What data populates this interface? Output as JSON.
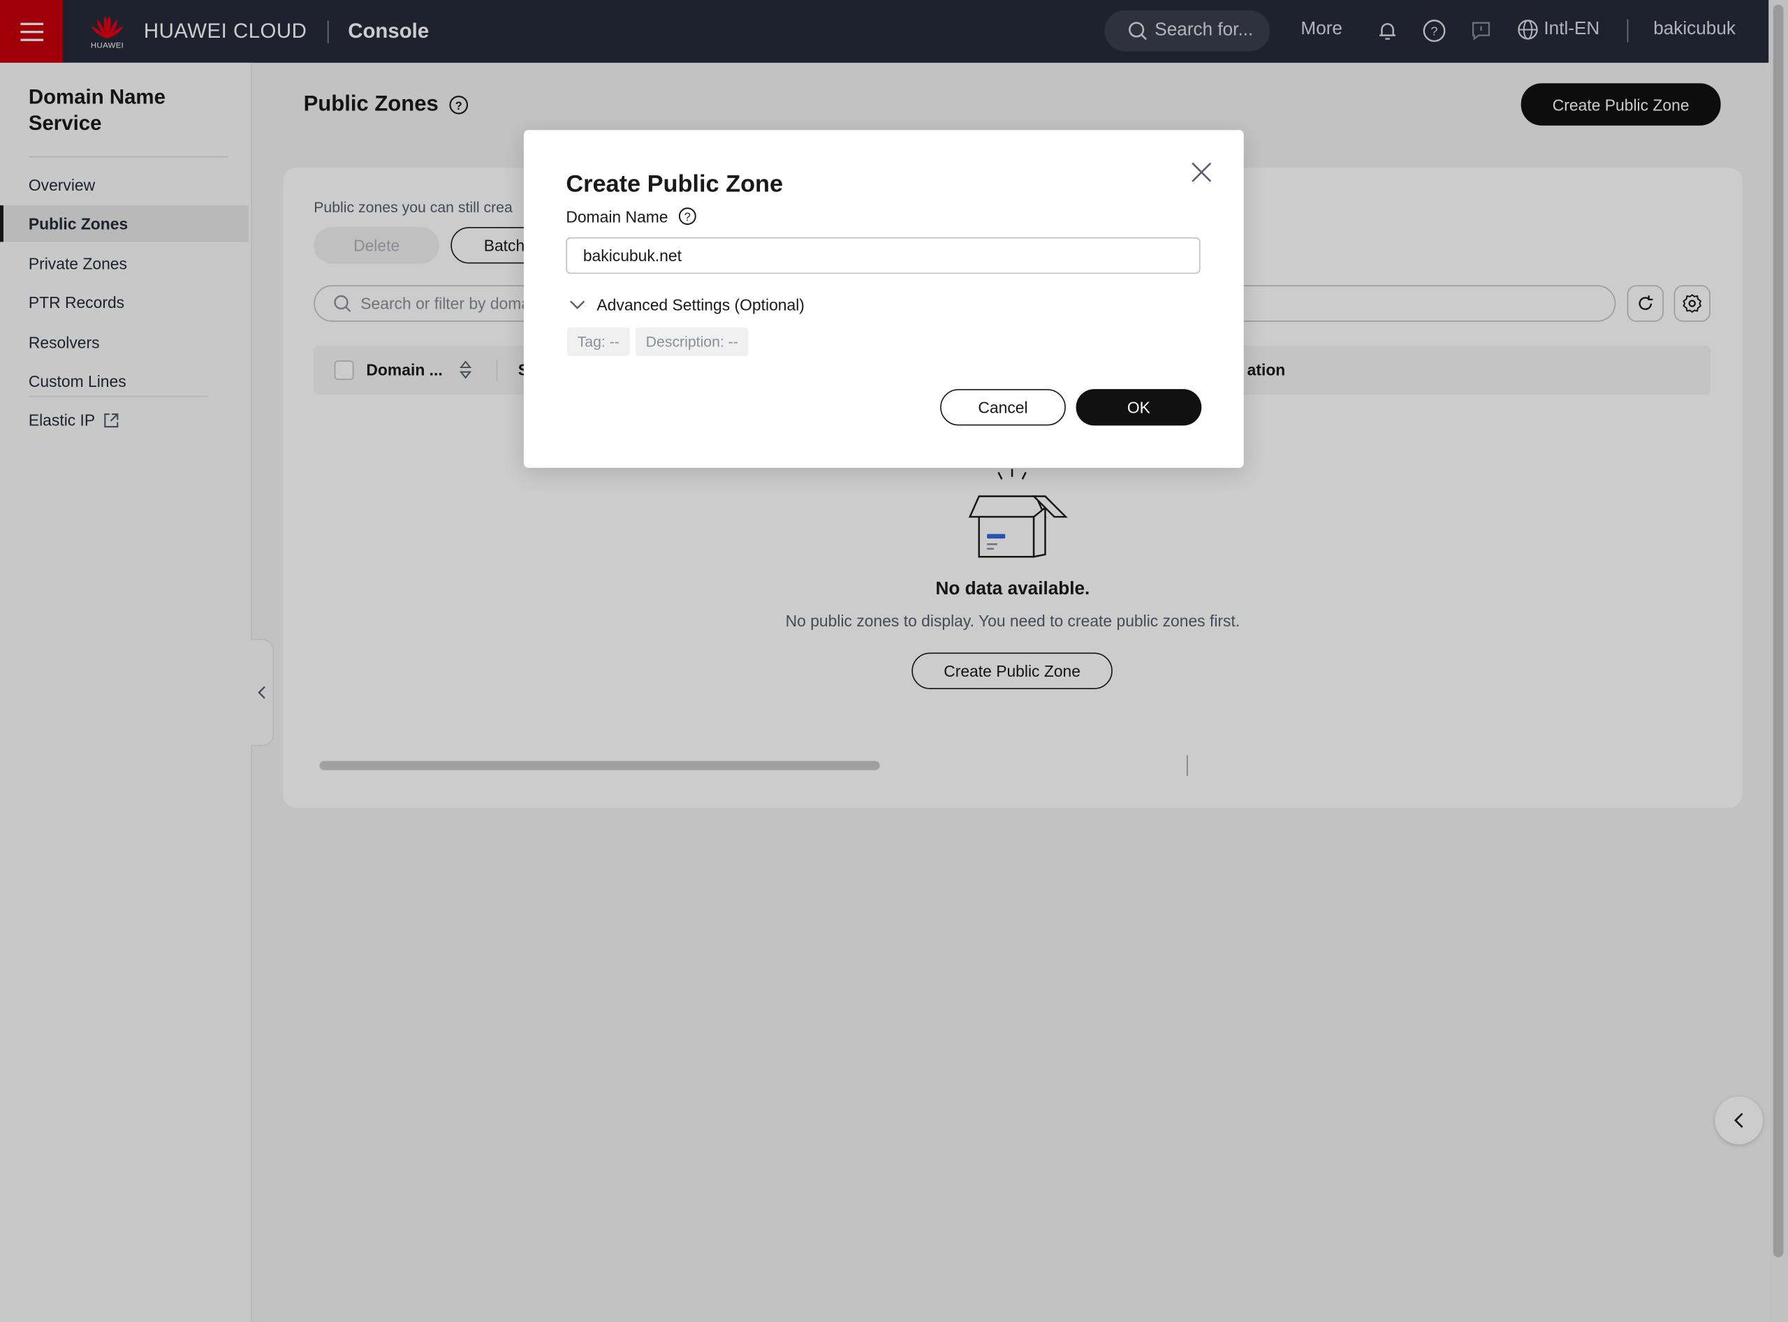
{
  "topbar": {
    "logo_text": "HUAWEI",
    "brand": "HUAWEI CLOUD",
    "console": "Console",
    "search_placeholder": "Search for...",
    "more": "More",
    "language": "Intl-EN",
    "username": "bakicubuk",
    "icons": [
      "menu-icon",
      "bell-icon",
      "help-icon",
      "feedback-icon",
      "globe-icon"
    ]
  },
  "sidebar": {
    "title": "Domain Name Service",
    "items": [
      {
        "label": "Overview"
      },
      {
        "label": "Public Zones",
        "active": true
      },
      {
        "label": "Private Zones"
      },
      {
        "label": "PTR Records"
      },
      {
        "label": "Resolvers"
      },
      {
        "label": "Custom Lines"
      },
      {
        "label": "Elastic IP",
        "external": true
      }
    ]
  },
  "main": {
    "title": "Public Zones",
    "create_button": "Create Public Zone",
    "quota_text": "Public zones you can still crea",
    "delete_button": "Delete",
    "batch_button": "Batch",
    "search_placeholder": "Search or filter by doma",
    "columns": [
      "Domain ...",
      "S",
      "ation"
    ],
    "empty_title": "No data available.",
    "empty_subtitle": "No public zones to display. You need to create public zones first.",
    "empty_create_button": "Create Public Zone"
  },
  "modal": {
    "title": "Create Public Zone",
    "domain_label": "Domain Name",
    "domain_value": "bakicubuk.net",
    "advanced_label": "Advanced Settings (Optional)",
    "tag_chip": "Tag: --",
    "description_chip": "Description: --",
    "cancel": "Cancel",
    "ok": "OK"
  },
  "colors": {
    "topbar_bg": "#252b3a",
    "brand_red": "#c7000b",
    "primary_button": "#111111"
  }
}
